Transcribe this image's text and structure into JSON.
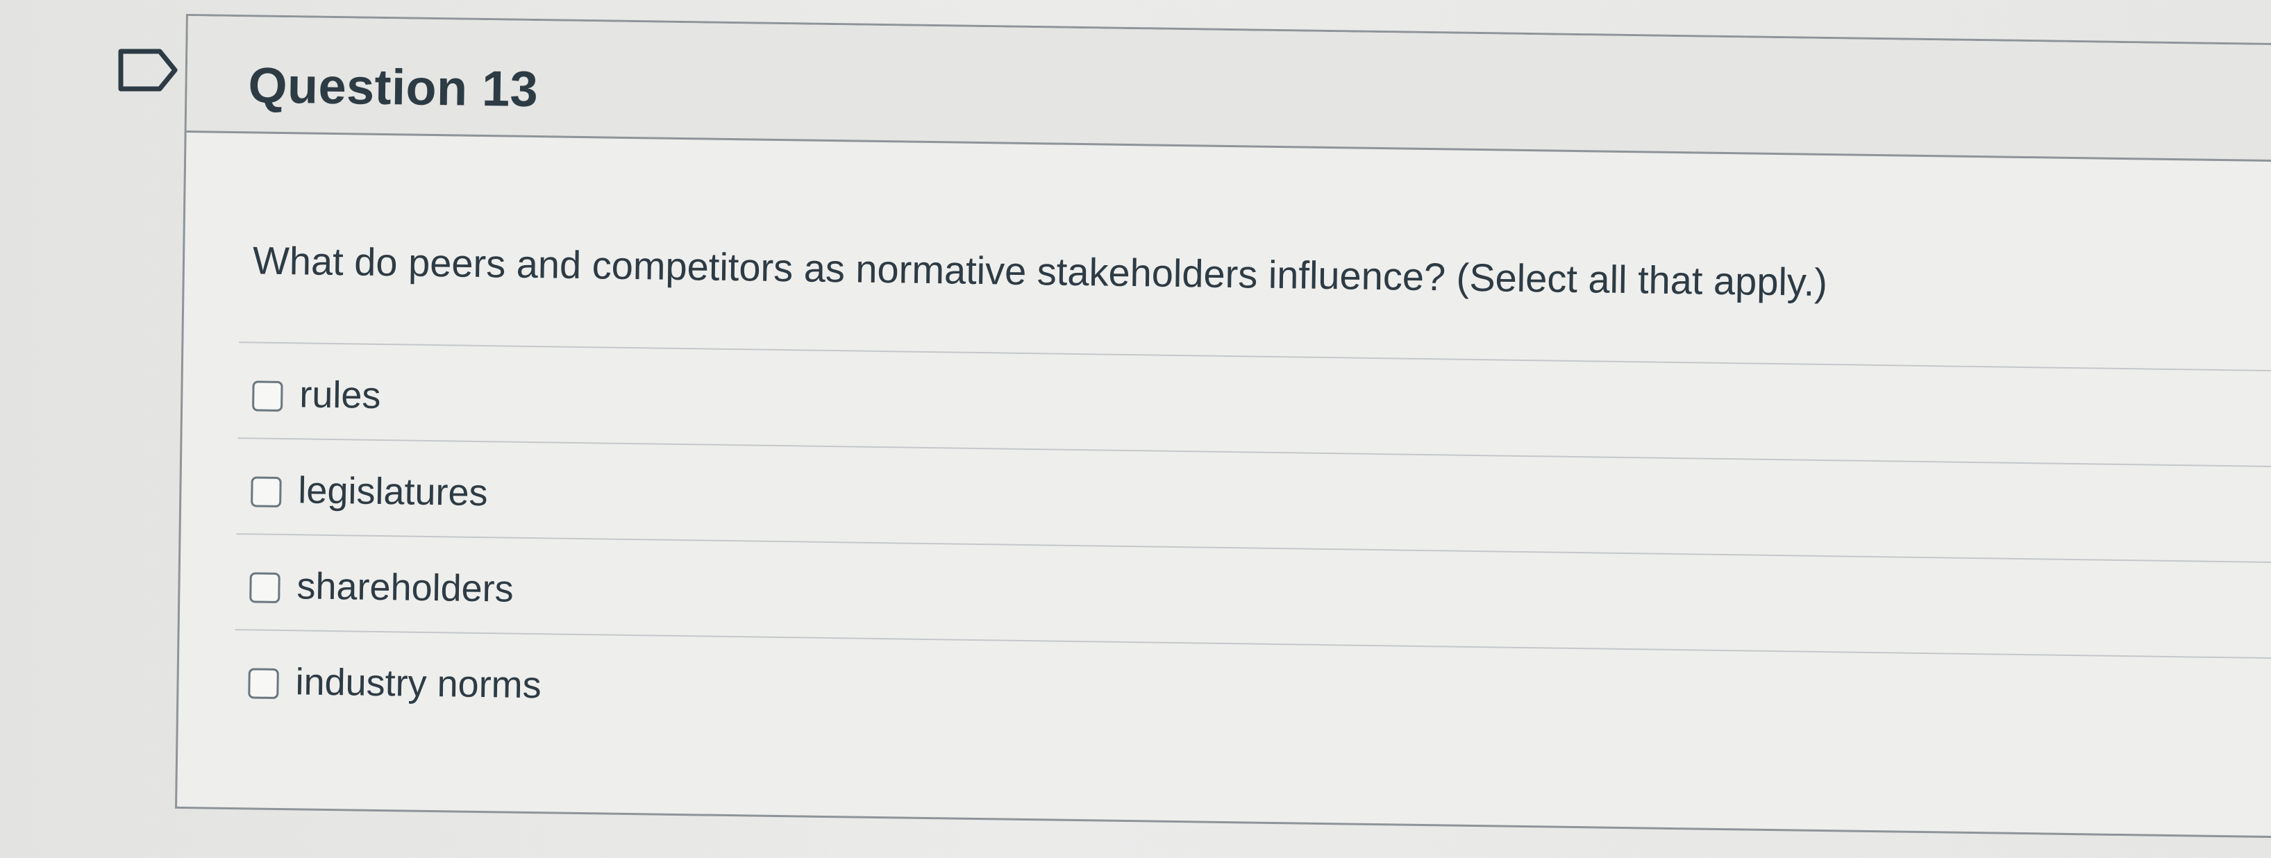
{
  "question": {
    "title": "Question 13",
    "text": "What do peers and competitors as normative stakeholders influence? (Select all that apply.)",
    "flag_icon": "flag-icon"
  },
  "answers": [
    {
      "label": "rules",
      "checked": false
    },
    {
      "label": "legislatures",
      "checked": false
    },
    {
      "label": "shareholders",
      "checked": false
    },
    {
      "label": "industry norms",
      "checked": false
    }
  ],
  "colors": {
    "text": "#2d3b45",
    "border": "#8e9499",
    "background": "#eeeeec"
  }
}
